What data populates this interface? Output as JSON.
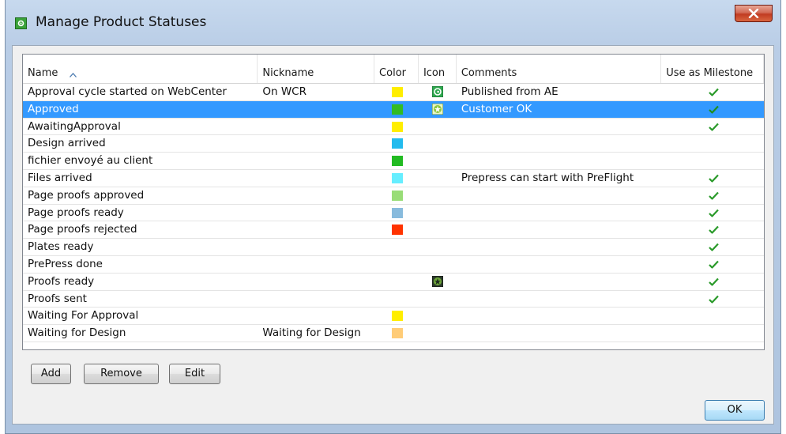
{
  "window": {
    "title": "Manage Product Statuses"
  },
  "grid": {
    "columns": [
      {
        "key": "name",
        "label": "Name",
        "cls": "c-name",
        "sorted": true
      },
      {
        "key": "nickname",
        "label": "Nickname",
        "cls": "c-nick"
      },
      {
        "key": "color",
        "label": "Color",
        "cls": "c-color"
      },
      {
        "key": "icon",
        "label": "Icon",
        "cls": "c-icon"
      },
      {
        "key": "comments",
        "label": "Comments",
        "cls": "c-comm"
      },
      {
        "key": "milestone",
        "label": "Use as Milestone",
        "cls": "c-mile"
      }
    ],
    "rows": [
      {
        "name": "Approval cycle started on WebCenter",
        "nickname": "On WCR",
        "color": "#ffee00",
        "icon": "webcenter-icon",
        "comments": "Published from AE",
        "milestone": true
      },
      {
        "name": "Approved",
        "nickname": "",
        "color": "#33bb22",
        "icon": "approved-star-icon",
        "comments": "Customer OK",
        "milestone": true,
        "selected": true
      },
      {
        "name": "AwaitingApproval",
        "nickname": "",
        "color": "#ffee00",
        "icon": "",
        "comments": "",
        "milestone": true
      },
      {
        "name": "Design arrived",
        "nickname": "",
        "color": "#22bbee",
        "icon": "",
        "comments": "",
        "milestone": false
      },
      {
        "name": "fichier envoyé au client",
        "nickname": "",
        "color": "#22bb22",
        "icon": "",
        "comments": "",
        "milestone": false
      },
      {
        "name": "Files arrived",
        "nickname": "",
        "color": "#66eeff",
        "icon": "",
        "comments": "Prepress can start with PreFlight",
        "milestone": true
      },
      {
        "name": "Page proofs approved",
        "nickname": "",
        "color": "#99dd77",
        "icon": "",
        "comments": "",
        "milestone": true
      },
      {
        "name": "Page proofs ready",
        "nickname": "",
        "color": "#88bbdd",
        "icon": "",
        "comments": "",
        "milestone": true
      },
      {
        "name": "Page proofs rejected",
        "nickname": "",
        "color": "#ff3300",
        "icon": "",
        "comments": "",
        "milestone": true
      },
      {
        "name": "Plates ready",
        "nickname": "",
        "color": "",
        "icon": "",
        "comments": "",
        "milestone": true
      },
      {
        "name": "PrePress done",
        "nickname": "",
        "color": "",
        "icon": "",
        "comments": "",
        "milestone": true
      },
      {
        "name": "Proofs ready",
        "nickname": "",
        "color": "",
        "icon": "proofs-star-icon",
        "comments": "",
        "milestone": true
      },
      {
        "name": "Proofs sent",
        "nickname": "",
        "color": "",
        "icon": "",
        "comments": "",
        "milestone": true
      },
      {
        "name": "Waiting For Approval",
        "nickname": "",
        "color": "#ffee00",
        "icon": "",
        "comments": "",
        "milestone": false
      },
      {
        "name": "Waiting for Design",
        "nickname": "Waiting for Design",
        "color": "#ffcc77",
        "icon": "",
        "comments": "",
        "milestone": false
      }
    ]
  },
  "buttons": {
    "add": "Add",
    "remove": "Remove",
    "edit": "Edit",
    "ok": "OK"
  },
  "colors": {
    "selection": "#3399ff",
    "checkmark": "#2a9a2a"
  }
}
